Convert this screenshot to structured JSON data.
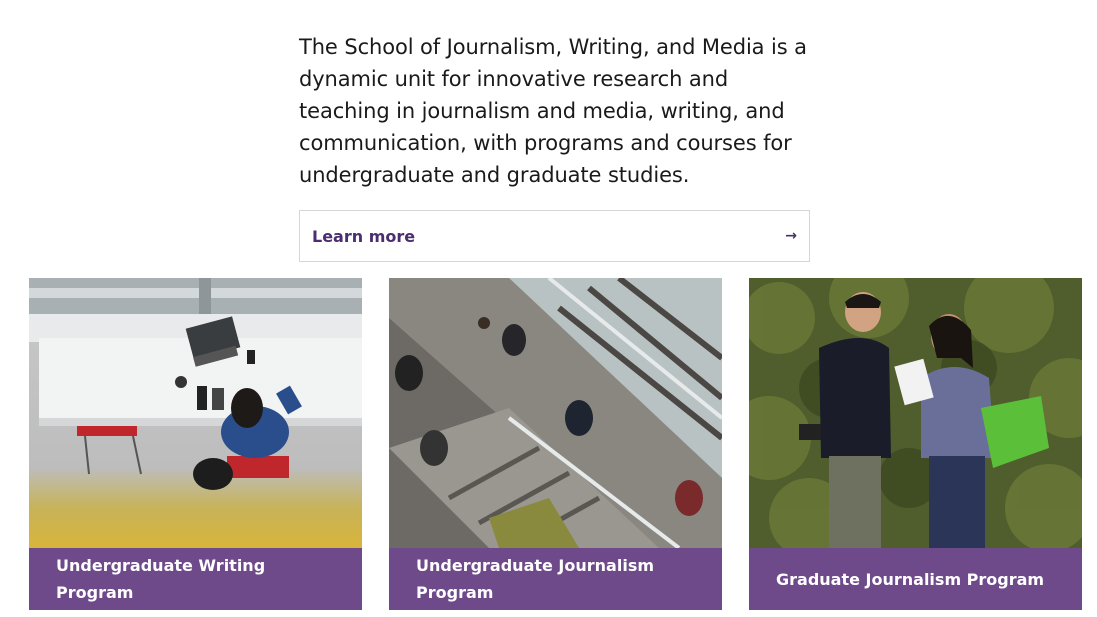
{
  "intro": {
    "text": "The School of Journalism, Writing, and Media is a dynamic unit for innovative research and teaching in journalism and media, writing, and communication, with programs and courses for undergraduate and graduate studies."
  },
  "learn_more": {
    "label": "Learn more",
    "arrow": "→"
  },
  "cards": [
    {
      "label": "Undergraduate Writing Program"
    },
    {
      "label": "Undergraduate Journalism Program"
    },
    {
      "label": "Graduate Journalism Program"
    }
  ],
  "colors": {
    "accent_purple": "#6e4a8a",
    "link_purple": "#4b2e6d"
  }
}
